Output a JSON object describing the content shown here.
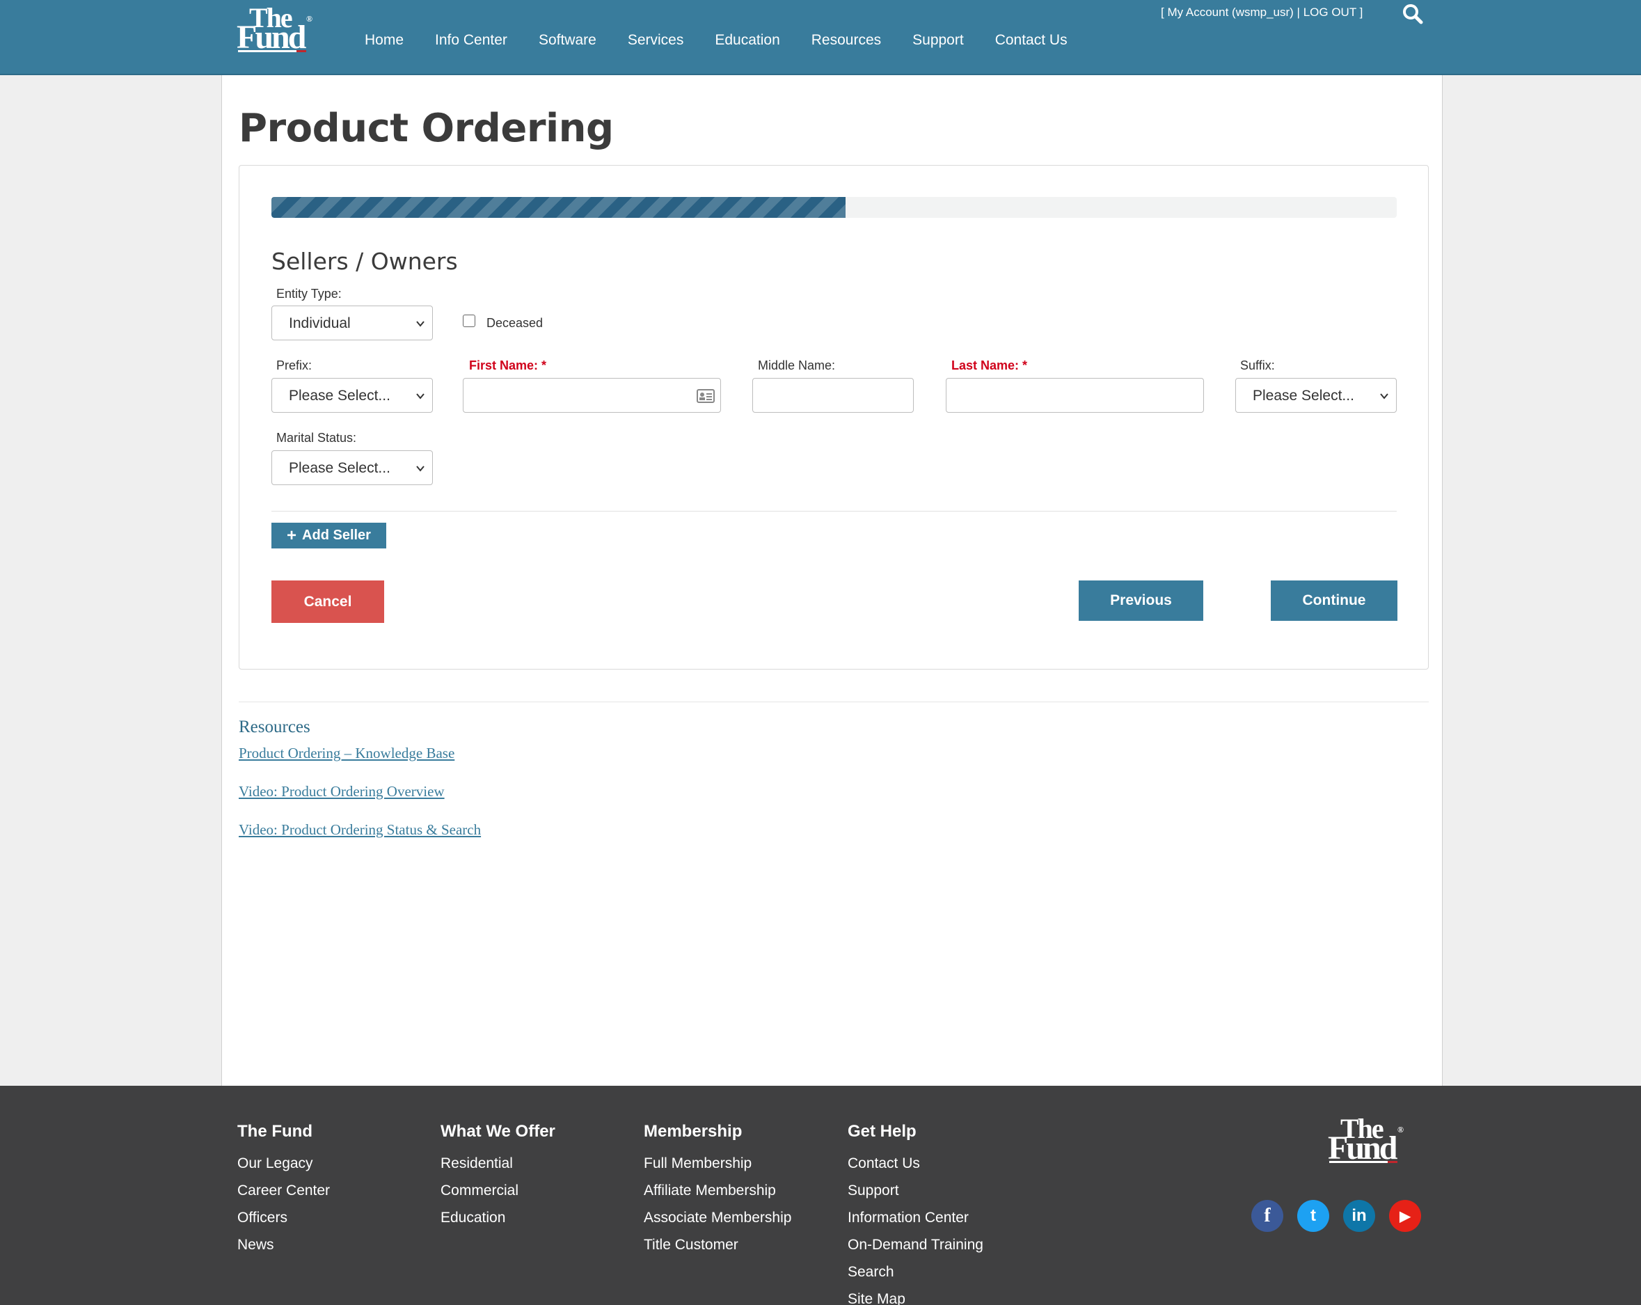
{
  "header": {
    "nav": [
      "Home",
      "Info Center",
      "Software",
      "Services",
      "Education",
      "Resources",
      "Support",
      "Contact Us"
    ],
    "account_text": "[  My Account (wsmp_usr) | LOG OUT ]",
    "logo_icon": "the-fund-logo"
  },
  "page": {
    "title": "Product Ordering",
    "progress_percent": 51
  },
  "form": {
    "section_title": "Sellers / Owners",
    "entity_type_label": "Entity Type:",
    "entity_type_value": "Individual",
    "deceased_label": "Deceased",
    "prefix_label": "Prefix:",
    "prefix_value": "Please Select...",
    "first_name_label": "First Name: *",
    "first_name_value": "",
    "middle_name_label": "Middle Name:",
    "middle_name_value": "",
    "last_name_label": "Last Name: *",
    "last_name_value": "",
    "suffix_label": "Suffix:",
    "suffix_value": "Please Select...",
    "marital_status_label": "Marital Status:",
    "marital_status_value": "Please Select...",
    "add_seller_label": "Add Seller",
    "cancel_label": "Cancel",
    "previous_label": "Previous",
    "continue_label": "Continue"
  },
  "resources": {
    "title": "Resources",
    "links": [
      "Product Ordering – Knowledge Base",
      "Video: Product Ordering Overview",
      "Video: Product Ordering Status & Search"
    ]
  },
  "footer": {
    "columns": [
      {
        "title": "The Fund",
        "items": [
          "Our Legacy",
          "Career Center",
          "Officers",
          "News"
        ]
      },
      {
        "title": "What We Offer",
        "items": [
          "Residential",
          "Commercial",
          "Education"
        ]
      },
      {
        "title": "Membership",
        "items": [
          "Full Membership",
          "Affiliate Membership",
          "Associate Membership",
          "Title Customer"
        ]
      },
      {
        "title": "Get Help",
        "items": [
          "Contact Us",
          "Support",
          "Information Center",
          "On-Demand Training",
          "Search",
          "Site Map"
        ]
      }
    ],
    "social": [
      {
        "icon": "facebook-icon",
        "glyph": "f",
        "color": "#3b5998"
      },
      {
        "icon": "twitter-icon",
        "glyph": "t",
        "color": "#1da1f2"
      },
      {
        "icon": "linkedin-icon",
        "glyph": "in",
        "color": "#0e76a8"
      },
      {
        "icon": "youtube-icon",
        "glyph": "▶",
        "color": "#e62117"
      }
    ]
  },
  "colors": {
    "header_bg": "#397c9c",
    "primary_button": "#397c9c",
    "cancel_button": "#d9534f",
    "progress_fill": "#2a6184",
    "required_label": "#d0021b",
    "footer_bg": "#404041"
  }
}
